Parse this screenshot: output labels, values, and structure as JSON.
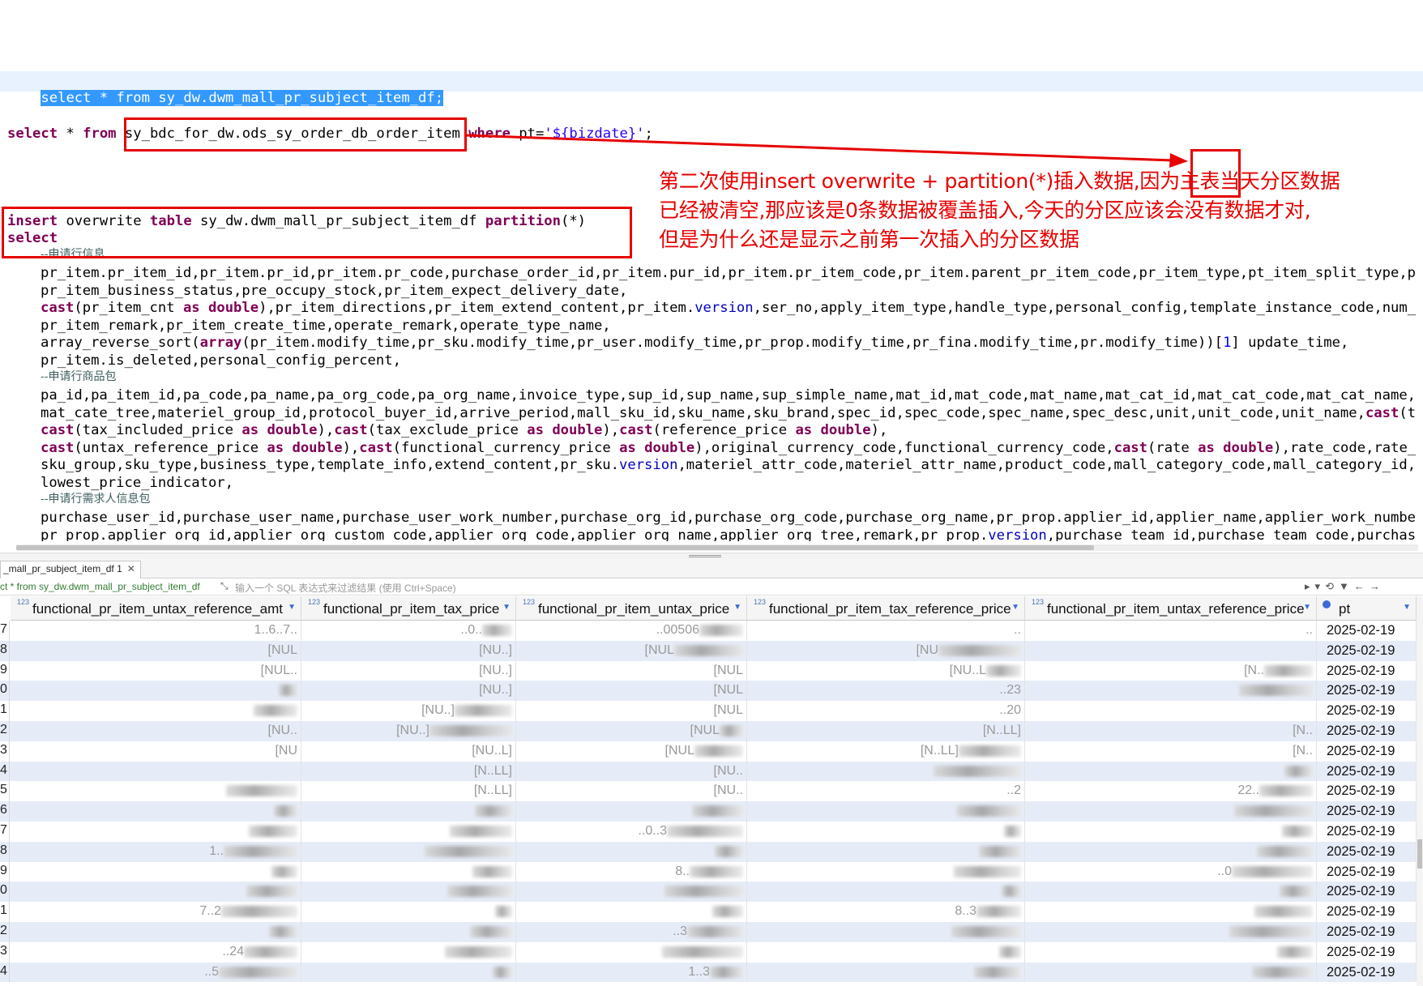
{
  "editor": {
    "line1": "select * from sy_dw.dwm_mall_pr_subject_item_df;",
    "line2": {
      "kw_select": "select",
      "star": " * ",
      "kw_from": "from",
      "table": "sy_bdc_for_dw.ods_sy_order_db_order_item",
      "kw_where": "where",
      "cond_left": " pt=",
      "cond_value": "'${bizdate}'",
      "semicolon": ";"
    },
    "insert_line": {
      "kw_insert": "insert",
      "kw_overwrite": " overwrite ",
      "kw_table": "table",
      "table": " sy_dw.dwm_mall_pr_subject_item_df ",
      "kw_partition": "partition",
      "tail": "(*)"
    },
    "select_kw": "select",
    "comment1": "--申请行信息",
    "l1": "pr_item.pr_item_id,pr_item.pr_id,pr_item.pr_code,purchase_order_id,pr_item.pur_id,pr_item.pr_item_code,pr_item.parent_pr_item_code,pr_item_type,pt_item_split_type,p",
    "l2": "pr_item_business_status,pre_occupy_stock,pr_item_expect_delivery_date,",
    "l3": {
      "cast1": "cast",
      "a": "(pr_item_cnt ",
      "as1": "as",
      "sp": " ",
      "double1": "double",
      "b": "),pr_item_directions,pr_item_extend_content,pr_item.",
      "version": "version",
      "c": ",ser_no,apply_item_type,handle_type,personal_config,template_instance_code,num_"
    },
    "l4": "pr_item_remark,pr_item_create_time,operate_remark,operate_type_name,",
    "l5": {
      "fn": "array_reverse_sort",
      "lp": "(",
      "arr": "array",
      "mid": "(pr_item.modify_time,pr_sku.modify_time,pr_user.modify_time,pr_prop.modify_time,pr_fina.modify_time,pr.modify_time))[",
      "idx": "1",
      "end": "] update_time,"
    },
    "l6": "pr_item.is_deleted,personal_config_percent,",
    "comment2": "--申请行商品包",
    "l7": "pa_id,pa_item_id,pa_code,pa_name,pa_org_code,pa_org_name,invoice_type,sup_id,sup_name,sup_simple_name,mat_id,mat_code,mat_name,mat_cat_id,mat_cat_code,mat_cat_name,",
    "l8": {
      "a": "mat_cate_tree,materiel_group_id,protocol_buyer_id,arrive_period,mall_sku_id,sku_name,sku_brand,spec_id,spec_code,spec_name,spec_desc,unit,unit_code,unit_name,",
      "cast": "cast",
      "b": "(t"
    },
    "l9": {
      "cast1": "cast",
      "a": "(tax_included_price ",
      "as1": "as",
      "double1": "double",
      "b": "),",
      "cast2": "cast",
      "c": "(tax_exclude_price ",
      "as2": "as",
      "double2": "double",
      "d": "),",
      "cast3": "cast",
      "e": "(reference_price ",
      "as3": "as",
      "double3": "double",
      "f": "),"
    },
    "l10": {
      "cast1": "cast",
      "a": "(untax_reference_price ",
      "as1": "as",
      "double1": "double",
      "b": "),",
      "cast2": "cast",
      "c": "(functional_currency_price ",
      "as2": "as",
      "double2": "double",
      "d": "),original_currency_code,functional_currency_code,",
      "cast3": "cast",
      "e": "(rate ",
      "as3": "as",
      "double3": "double",
      "f": "),rate_code,rate_"
    },
    "l11": {
      "a": "sku_group,sku_type,business_type,template_info,extend_content,pr_sku.",
      "version": "version",
      "b": ",materiel_attr_code,materiel_attr_name,product_code,mall_category_code,mall_category_id,"
    },
    "l12": "lowest_price_indicator,",
    "comment3": "--申请行需求人信息包",
    "l13": "purchase_user_id,purchase_user_name,purchase_user_work_number,purchase_org_id,purchase_org_code,purchase_org_name,pr_prop.applier_id,applier_name,applier_work_numbe",
    "l14": {
      "a": "pr_prop.applier_org_id,applier_org_custom_code,applier_org_code,applier_org_name,applier_org_tree,remark,pr_prop.",
      "version": "version",
      "b": ",purchase_team_id,purchase_team_code,purchas"
    }
  },
  "annotation": {
    "line1": "第二次使用insert overwrite + partition(*)插入数据,因为主表当天分区数据",
    "line2": "已经被清空,那应该是0条数据被覆盖插入,今天的分区应该会没有数据才对,",
    "line3": "但是为什么还是显示之前第一次插入的分区数据",
    "color": "#e60000"
  },
  "results": {
    "tab_label": "_mall_pr_subject_item_df 1",
    "tab_close": "✕",
    "filter_sql": "ct * from sy_dw.dwm_mall_pr_subject_item_df",
    "filter_placeholder": "输入一个 SQL 表达式来过滤结果 (使用 Ctrl+Space)",
    "type_badge": "123",
    "columns": [
      "functional_pr_item_untax_reference_amt",
      "functional_pr_item_tax_price",
      "functional_pr_item_untax_price",
      "functional_pr_item_tax_reference_price",
      "functional_pr_item_untax_reference_price",
      "pt"
    ],
    "row_numbers": [
      "7",
      "8",
      "9",
      "0",
      "1",
      "2",
      "3",
      "4",
      "5",
      "6",
      "7",
      "8",
      "9",
      "0",
      "1",
      "2",
      "3",
      "4"
    ],
    "cells": [
      [
        "1..6..7..",
        "..0..",
        "..00506",
        "..",
        "..",
        ""
      ],
      [
        "[NUL",
        "[NU..]",
        "[NUL",
        "[NU",
        "",
        ""
      ],
      [
        "[NUL..",
        "[NU..]",
        "[NUL",
        "[NU..L",
        "[N..",
        ""
      ],
      [
        "",
        "[NU..]",
        "[NUL",
        "..23",
        "",
        ""
      ],
      [
        "",
        "[NU..]",
        "[NUL",
        "..20",
        "",
        ""
      ],
      [
        "[NU..",
        "[NU..]",
        "[NUL",
        "[N..LL]",
        "[N..",
        ""
      ],
      [
        "[NU",
        "[NU..L]",
        "[NUL",
        "[N..LL]",
        "[N..",
        ""
      ],
      [
        "",
        "[N..LL]",
        "[NU..",
        "",
        "",
        ""
      ],
      [
        "",
        "[N..LL]",
        "[NU..",
        "..2",
        "22..",
        ""
      ],
      [
        "",
        "",
        "",
        "",
        "",
        ""
      ],
      [
        "",
        "",
        "..0..3",
        "",
        "",
        ""
      ],
      [
        "1..",
        "",
        "",
        "",
        "",
        ""
      ],
      [
        "",
        "",
        "8..",
        "",
        "..0",
        ""
      ],
      [
        "",
        "",
        "",
        "",
        "",
        ""
      ],
      [
        "7..2",
        "",
        "",
        "8..3",
        "",
        ""
      ],
      [
        "",
        "",
        "..3",
        "",
        "",
        ""
      ],
      [
        "..24",
        "",
        "",
        "",
        "",
        ""
      ],
      [
        "..5",
        "",
        "1..3",
        "",
        "",
        ""
      ]
    ],
    "pt_value": "2025-02-19"
  },
  "toolbar_icons": [
    "arrow-right-icon",
    "dropdown-icon",
    "history-icon",
    "filter-icon",
    "back-icon",
    "forward-icon"
  ]
}
